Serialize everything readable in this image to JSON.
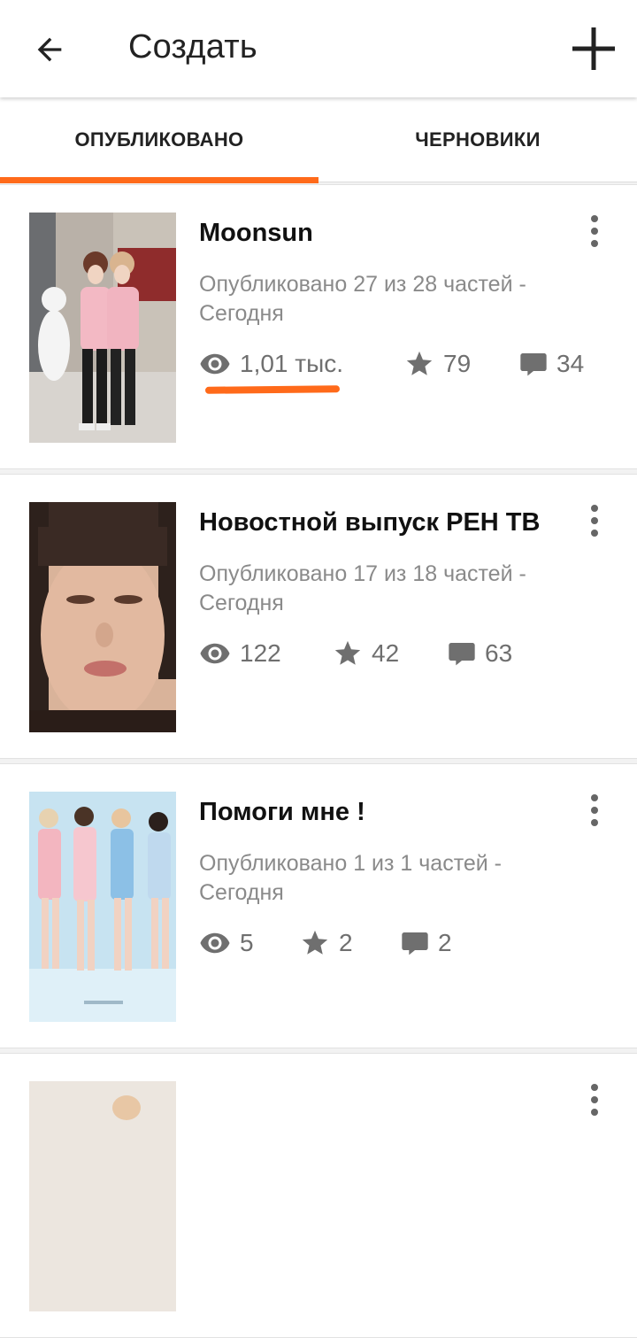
{
  "appbar": {
    "title": "Создать",
    "back_icon": "arrow-left-icon",
    "add_icon": "plus-icon"
  },
  "tabs": [
    {
      "label": "ОПУБЛИКОВАНО",
      "active": true
    },
    {
      "label": "ЧЕРНОВИКИ",
      "active": false
    }
  ],
  "colors": {
    "accent": "#ff6a1a",
    "stat_gray": "#6f6f6f",
    "meta_gray": "#8a8a8a"
  },
  "stories": [
    {
      "title": "Moonsun",
      "meta_line1": "Опубликовано 27 из 28 частей -",
      "meta_line2": "Сегодня",
      "views": "1,01 тыс.",
      "votes": "79",
      "comments": "34"
    },
    {
      "title": "Новостной выпуск РЕН ТВ",
      "meta_line1": "Опубликовано 17 из 18 частей -",
      "meta_line2": "Сегодня",
      "views": "122",
      "votes": "42",
      "comments": "63"
    },
    {
      "title": "Помоги мне !",
      "meta_line1": "Опубликовано 1 из 1 частей -",
      "meta_line2": "Сегодня",
      "views": "5",
      "votes": "2",
      "comments": "2"
    }
  ]
}
